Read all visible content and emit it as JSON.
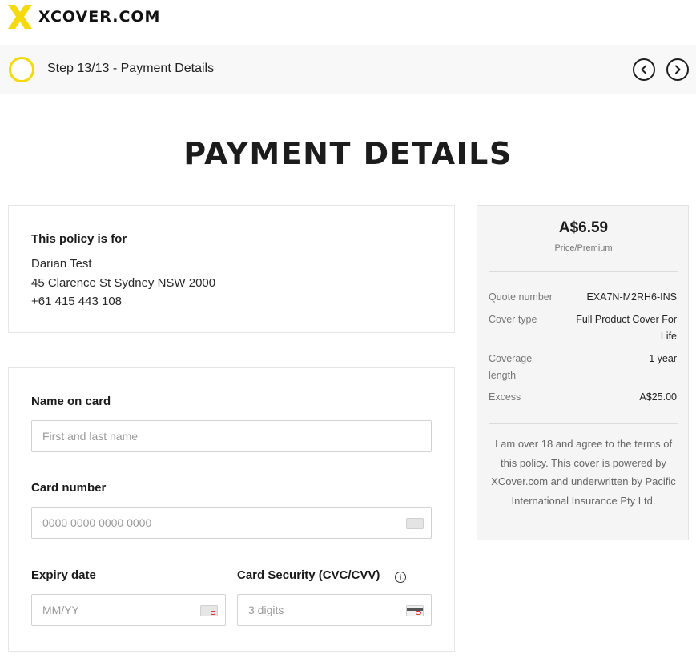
{
  "brand": {
    "name": "XCOVER.COM",
    "accent": "#f5d90a"
  },
  "stepbar": {
    "label": "Step 13/13 - Payment Details",
    "prev_icon": "chevron-left-icon",
    "next_icon": "chevron-right-icon"
  },
  "page": {
    "title": "PAYMENT DETAILS"
  },
  "policy": {
    "title": "This policy is for",
    "name": "Darian Test",
    "address": "45 Clarence St Sydney NSW 2000",
    "phone": "+61 415 443 108"
  },
  "form": {
    "name_label": "Name on card",
    "name_placeholder": "First and last name",
    "card_label": "Card number",
    "card_placeholder": "0000 0000 0000 0000",
    "expiry_label": "Expiry date",
    "expiry_placeholder": "MM/YY",
    "cvc_label": "Card Security (CVC/CVV)",
    "cvc_placeholder": "3 digits"
  },
  "summary": {
    "price": "A$6.59",
    "price_label": "Price/Premium",
    "rows": [
      {
        "label": "Quote number",
        "value": "EXA7N-M2RH6-INS"
      },
      {
        "label": "Cover type",
        "value": "Full Product Cover For Life"
      },
      {
        "label": "Coverage length",
        "value": "1 year"
      },
      {
        "label": "Excess",
        "value": "A$25.00"
      }
    ],
    "terms": "I am over 18 and agree to the terms of this policy. This cover is powered by XCover.com and underwritten by Pacific International Insurance Pty Ltd."
  }
}
